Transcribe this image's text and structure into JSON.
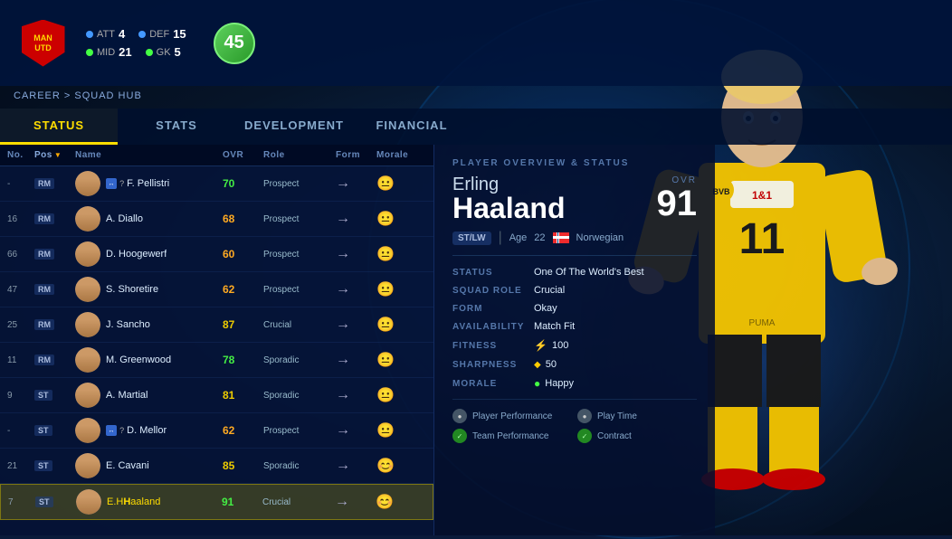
{
  "header": {
    "breadcrumb": "CAREER > SQUAD HUB",
    "overall_label": "45",
    "stats": {
      "att_label": "ATT",
      "att_value": "4",
      "def_label": "DEF",
      "def_value": "15",
      "mid_label": "MID",
      "mid_value": "21",
      "gk_label": "GK",
      "gk_value": "5"
    }
  },
  "nav_tabs": [
    {
      "id": "status",
      "label": "STATUS",
      "active": true
    },
    {
      "id": "stats",
      "label": "STATS",
      "active": false
    },
    {
      "id": "development",
      "label": "DEVELOPMENT",
      "active": false
    },
    {
      "id": "financial",
      "label": "FINANCIAL",
      "active": false
    }
  ],
  "table_headers": {
    "no": "No.",
    "pos": "Pos",
    "name": "Name",
    "ovr": "OVR",
    "role": "Role",
    "form": "Form",
    "morale": "Morale"
  },
  "players": [
    {
      "no": "-",
      "pos": "RM",
      "name": "F. Pellistri",
      "name_highlight": "",
      "ovr": "70",
      "ovr_color": "green",
      "role": "Prospect",
      "form": "→",
      "morale": "😐",
      "morale_happy": false,
      "has_transfer": true,
      "selected": false
    },
    {
      "no": "16",
      "pos": "RM",
      "name": "A. Diallo",
      "name_highlight": "",
      "ovr": "68",
      "ovr_color": "orange",
      "role": "Prospect",
      "form": "→",
      "morale": "😐",
      "morale_happy": false,
      "has_transfer": false,
      "selected": false
    },
    {
      "no": "66",
      "pos": "RM",
      "name": "D. Hoogewerf",
      "name_highlight": "",
      "ovr": "60",
      "ovr_color": "orange",
      "role": "Prospect",
      "form": "→",
      "morale": "😐",
      "morale_happy": false,
      "has_transfer": false,
      "selected": false
    },
    {
      "no": "47",
      "pos": "RM",
      "name": "S. Shoretire",
      "name_highlight": "",
      "ovr": "62",
      "ovr_color": "orange",
      "role": "Prospect",
      "form": "→",
      "morale": "😐",
      "morale_happy": false,
      "has_transfer": false,
      "selected": false
    },
    {
      "no": "25",
      "pos": "RM",
      "name": "J. Sancho",
      "name_highlight": "",
      "ovr": "87",
      "ovr_color": "yellow",
      "role": "Crucial",
      "form": "→",
      "morale": "😐",
      "morale_happy": false,
      "has_transfer": false,
      "selected": false
    },
    {
      "no": "11",
      "pos": "RM",
      "name": "M. Greenwood",
      "name_highlight": "",
      "ovr": "78",
      "ovr_color": "green",
      "role": "Sporadic",
      "form": "→",
      "morale": "😐",
      "morale_happy": false,
      "has_transfer": false,
      "selected": false
    },
    {
      "no": "9",
      "pos": "ST",
      "name": "A. Martial",
      "name_highlight": "",
      "ovr": "81",
      "ovr_color": "yellow",
      "role": "Sporadic",
      "form": "→",
      "morale": "😐",
      "morale_happy": false,
      "has_transfer": false,
      "selected": false
    },
    {
      "no": "-",
      "pos": "ST",
      "name": "D. Mellor",
      "name_highlight": "",
      "ovr": "62",
      "ovr_color": "orange",
      "role": "Prospect",
      "form": "→",
      "morale": "😐",
      "morale_happy": false,
      "has_transfer": true,
      "selected": false
    },
    {
      "no": "21",
      "pos": "ST",
      "name": "E. Cavani",
      "name_highlight": "",
      "ovr": "85",
      "ovr_color": "yellow",
      "role": "Sporadic",
      "form": "→",
      "morale": "😊",
      "morale_happy": true,
      "has_transfer": false,
      "selected": false
    },
    {
      "no": "7",
      "pos": "ST",
      "name_prefix": "E.H",
      "name_suffix": "aaland",
      "name": "E.Haaland",
      "name_highlight": "H",
      "ovr": "91",
      "ovr_color": "green",
      "role": "Crucial",
      "form": "→",
      "morale": "😊",
      "morale_happy": true,
      "has_transfer": false,
      "selected": true
    }
  ],
  "player_overview": {
    "panel_title": "PLAYER OVERVIEW & STATUS",
    "first_name": "Erling",
    "last_name": "Haaland",
    "ovr_label": "OVR",
    "ovr_value": "91",
    "position": "ST/LW",
    "age_label": "Age",
    "age": "22",
    "nationality": "Norwegian",
    "status_label": "STATUS",
    "status_value": "One Of The World's Best",
    "squad_role_label": "SQUAD ROLE",
    "squad_role_value": "Crucial",
    "form_label": "FORM",
    "form_value": "Okay",
    "availability_label": "AVAILABILITY",
    "availability_value": "Match Fit",
    "fitness_label": "FITNESS",
    "fitness_value": "100",
    "sharpness_label": "SHARPNESS",
    "sharpness_value": "50",
    "morale_label": "MORALE",
    "morale_value": "Happy",
    "badges": [
      {
        "label": "Player Performance",
        "type": "gray"
      },
      {
        "label": "Play Time",
        "type": "gray"
      },
      {
        "label": "Team Performance",
        "type": "green"
      },
      {
        "label": "Contract",
        "type": "green"
      }
    ]
  }
}
